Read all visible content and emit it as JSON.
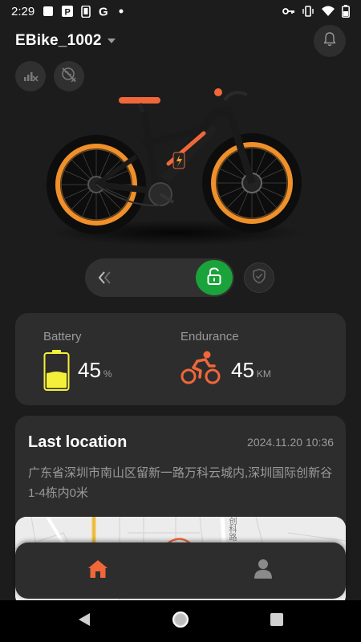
{
  "status_bar": {
    "time": "2:29",
    "icons": [
      "notification-square-icon",
      "parking-icon",
      "phone-icon",
      "google-icon",
      "dot-icon",
      "key-icon",
      "vibrate-icon",
      "wifi-icon",
      "battery-icon"
    ]
  },
  "header": {
    "device_name": "EBike_1002",
    "icons": [
      "caret-down-icon",
      "bell-icon",
      "signal-off-icon",
      "gps-off-icon"
    ]
  },
  "lock": {
    "state": "unlocked",
    "icons": [
      "double-chevron-left-icon",
      "unlock-icon",
      "shield-check-icon"
    ],
    "accent": "#1aa33a"
  },
  "stats": {
    "battery_label": "Battery",
    "battery_value": "45",
    "battery_unit": "%",
    "battery_level": 0.45,
    "endurance_label": "Endurance",
    "endurance_value": "45",
    "endurance_unit": "KM"
  },
  "location": {
    "title": "Last location",
    "timestamp": "2024.11.20 10:36",
    "address": "广东省深圳市南山区留新一路万科云城内,深圳国际创新谷1-4栋内0米",
    "map_text": "创科路"
  },
  "bottom_nav": {
    "items": [
      "home-icon",
      "profile-icon"
    ],
    "active_color": "#f0673a"
  },
  "colors": {
    "background": "#1c1c1c",
    "card": "#2d2d2d",
    "accent_orange": "#f0673a",
    "battery_yellow": "#f4f03a"
  }
}
